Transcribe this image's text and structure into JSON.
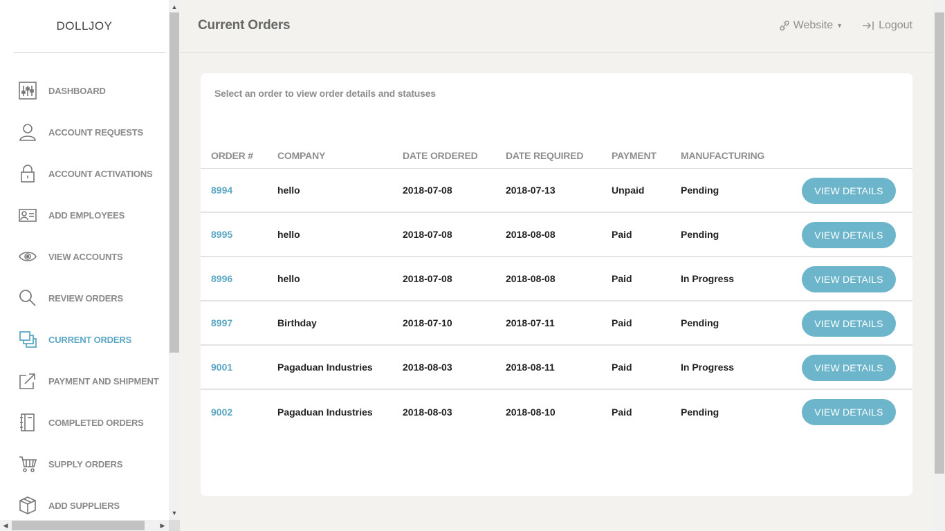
{
  "sidebar": {
    "brand": "DOLLJOY",
    "items": [
      {
        "label": "DASHBOARD",
        "icon": "sliders-icon"
      },
      {
        "label": "ACCOUNT REQUESTS",
        "icon": "user-icon"
      },
      {
        "label": "ACCOUNT ACTIVATIONS",
        "icon": "lock-icon"
      },
      {
        "label": "ADD EMPLOYEES",
        "icon": "id-card-icon"
      },
      {
        "label": "VIEW ACCOUNTS",
        "icon": "eye-icon"
      },
      {
        "label": "REVIEW ORDERS",
        "icon": "search-icon"
      },
      {
        "label": "CURRENT ORDERS",
        "icon": "stacked-squares-icon",
        "active": true
      },
      {
        "label": "PAYMENT AND SHIPMENT",
        "icon": "external-link-icon"
      },
      {
        "label": "COMPLETED ORDERS",
        "icon": "notebook-icon"
      },
      {
        "label": "SUPPLY ORDERS",
        "icon": "cart-icon"
      },
      {
        "label": "ADD SUPPLIERS",
        "icon": "box-icon"
      }
    ]
  },
  "header": {
    "title": "Current Orders",
    "website_label": "Website",
    "logout_label": "Logout"
  },
  "main": {
    "description": "Select an order to view order details and statuses",
    "columns": [
      "ORDER #",
      "COMPANY",
      "DATE ORDERED",
      "DATE REQUIRED",
      "PAYMENT",
      "MANUFACTURING"
    ],
    "button_label": "VIEW DETAILS",
    "rows": [
      {
        "order": "8994",
        "company": "hello",
        "date_ordered": "2018-07-08",
        "date_required": "2018-07-13",
        "payment": "Unpaid",
        "manufacturing": "Pending"
      },
      {
        "order": "8995",
        "company": "hello",
        "date_ordered": "2018-07-08",
        "date_required": "2018-08-08",
        "payment": "Paid",
        "manufacturing": "Pending"
      },
      {
        "order": "8996",
        "company": "hello",
        "date_ordered": "2018-07-08",
        "date_required": "2018-08-08",
        "payment": "Paid",
        "manufacturing": "In Progress"
      },
      {
        "order": "8997",
        "company": "Birthday",
        "date_ordered": "2018-07-10",
        "date_required": "2018-07-11",
        "payment": "Paid",
        "manufacturing": "Pending"
      },
      {
        "order": "9001",
        "company": "Pagaduan Industries",
        "date_ordered": "2018-08-03",
        "date_required": "2018-08-11",
        "payment": "Paid",
        "manufacturing": "In Progress"
      },
      {
        "order": "9002",
        "company": "Pagaduan Industries",
        "date_ordered": "2018-08-03",
        "date_required": "2018-08-10",
        "payment": "Paid",
        "manufacturing": "Pending"
      }
    ]
  },
  "colors": {
    "accent": "#5ba7c3",
    "button": "#6cb5cb",
    "muted_text": "#8a8a8a",
    "background": "#f3f2ef"
  }
}
